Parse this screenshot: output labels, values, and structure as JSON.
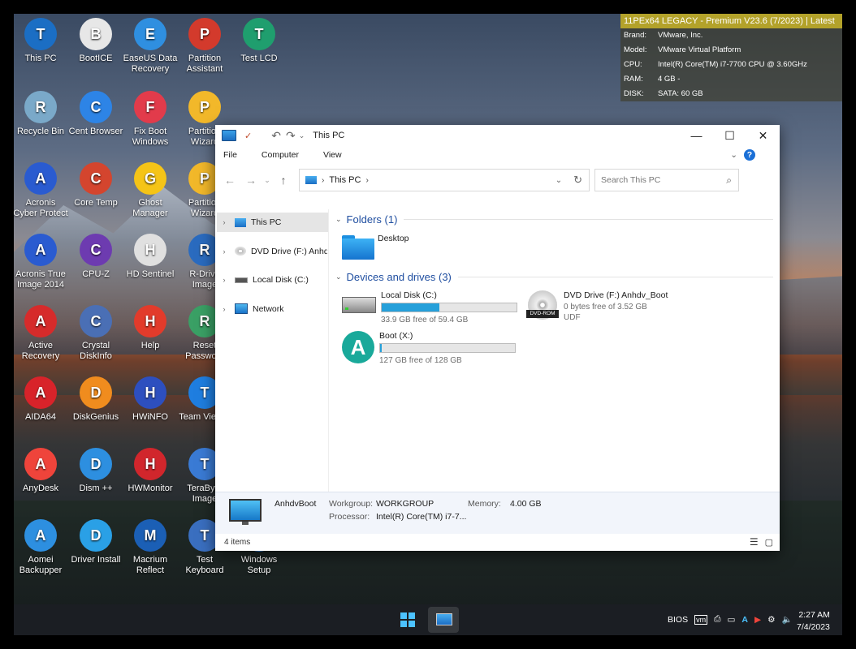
{
  "desktop": {
    "icons": [
      {
        "label": "This PC",
        "color": "#1b6ec4"
      },
      {
        "label": "BootICE",
        "color": "#e7e7e7"
      },
      {
        "label": "EaseUS Data Recovery",
        "color": "#2f8fe0"
      },
      {
        "label": "Partition Assistant",
        "color": "#d33a2c"
      },
      {
        "label": "Test LCD",
        "color": "#1f9e6e"
      },
      {
        "label": "Recycle Bin",
        "color": "#7aa9c9"
      },
      {
        "label": "Cent Browser",
        "color": "#2d84e6"
      },
      {
        "label": "Fix Boot Windows",
        "color": "#e23b4b"
      },
      {
        "label": "Partition Wizard",
        "color": "#f2b82a"
      },
      {
        "label": "Acronis Cyber Protect",
        "color": "#2a5bd0"
      },
      {
        "label": "Core Temp",
        "color": "#d4452e"
      },
      {
        "label": "Ghost Manager",
        "color": "#f5c417"
      },
      {
        "label": "Partition Wizard",
        "color": "#f2b82a"
      },
      {
        "label": "Acronis True Image 2014",
        "color": "#2a5bd0"
      },
      {
        "label": "CPU-Z",
        "color": "#6d3bb0"
      },
      {
        "label": "HD Sentinel",
        "color": "#e0e0e0"
      },
      {
        "label": "R-Drive Image",
        "color": "#2a6bbf"
      },
      {
        "label": "Active Recovery",
        "color": "#d62b2b"
      },
      {
        "label": "Crystal DiskInfo",
        "color": "#4a6fb5"
      },
      {
        "label": "Help",
        "color": "#e23b2b"
      },
      {
        "label": "Reset Passwo...",
        "color": "#3aa065"
      },
      {
        "label": "AIDA64",
        "color": "#d8232a"
      },
      {
        "label": "DiskGenius",
        "color": "#f08c1e"
      },
      {
        "label": "HWiNFO",
        "color": "#2d4fbf"
      },
      {
        "label": "Team Viewer",
        "color": "#1f7ee0"
      },
      {
        "label": "AnyDesk",
        "color": "#ef443b"
      },
      {
        "label": "Dism ++",
        "color": "#2d8fe0"
      },
      {
        "label": "HWMonitor",
        "color": "#d1262c"
      },
      {
        "label": "TeraByte Image",
        "color": "#3a7bd5"
      },
      {
        "label": "Aomei Backupper",
        "color": "#2d8fe0"
      },
      {
        "label": "Driver Install",
        "color": "#2aa0e6"
      },
      {
        "label": "Macrium Reflect",
        "color": "#1b5fb5"
      },
      {
        "label": "Test Keyboard",
        "color": "#3a6fc0"
      },
      {
        "label": "Windows Setup",
        "color": "#2f7fd8"
      }
    ]
  },
  "sysinfo": {
    "header": "11PEx64 LEGACY - Premium V23.6 (7/2023) | Latest",
    "rows": [
      {
        "k": "Brand:",
        "v": "VMware, Inc."
      },
      {
        "k": "Model:",
        "v": "VMware Virtual Platform"
      },
      {
        "k": "CPU:",
        "v": "Intel(R) Core(TM) i7-7700 CPU @ 3.60GHz"
      },
      {
        "k": "RAM:",
        "v": "4 GB -"
      },
      {
        "k": "DISK:",
        "v": "SATA: 60 GB"
      }
    ]
  },
  "explorer": {
    "title": "This PC",
    "menu": [
      "File",
      "Computer",
      "View"
    ],
    "address": "This PC",
    "search_placeholder": "Search This PC",
    "nav": [
      {
        "label": "This PC",
        "selected": true
      },
      {
        "label": "DVD Drive (F:) Anhdv_Boot"
      },
      {
        "label": "Local Disk (C:)"
      },
      {
        "label": "Network"
      }
    ],
    "folders_header": "Folders (1)",
    "folders": [
      {
        "name": "Desktop"
      }
    ],
    "devices_header": "Devices and drives (3)",
    "drives": [
      {
        "name": "Local Disk (C:)",
        "free": "33.9 GB free of 59.4 GB",
        "used_fraction": 0.43
      },
      {
        "name": "DVD Drive (F:) Anhdv_Boot",
        "free": "0 bytes free of 3.52 GB",
        "fs": "UDF",
        "icon_text": "DVD-ROM"
      },
      {
        "name": "Boot (X:)",
        "free": "127 GB free of 128 GB",
        "used_fraction": 0.01
      }
    ],
    "details": {
      "name": "AnhdvBoot",
      "workgroup_label": "Workgroup:",
      "workgroup": "WORKGROUP",
      "memory_label": "Memory:",
      "memory": "4.00 GB",
      "processor_label": "Processor:",
      "processor": "Intel(R) Core(TM) i7-7..."
    },
    "status": "4 items"
  },
  "taskbar": {
    "tray_bios": "BIOS",
    "time": "2:27 AM",
    "date": "7/4/2023"
  }
}
